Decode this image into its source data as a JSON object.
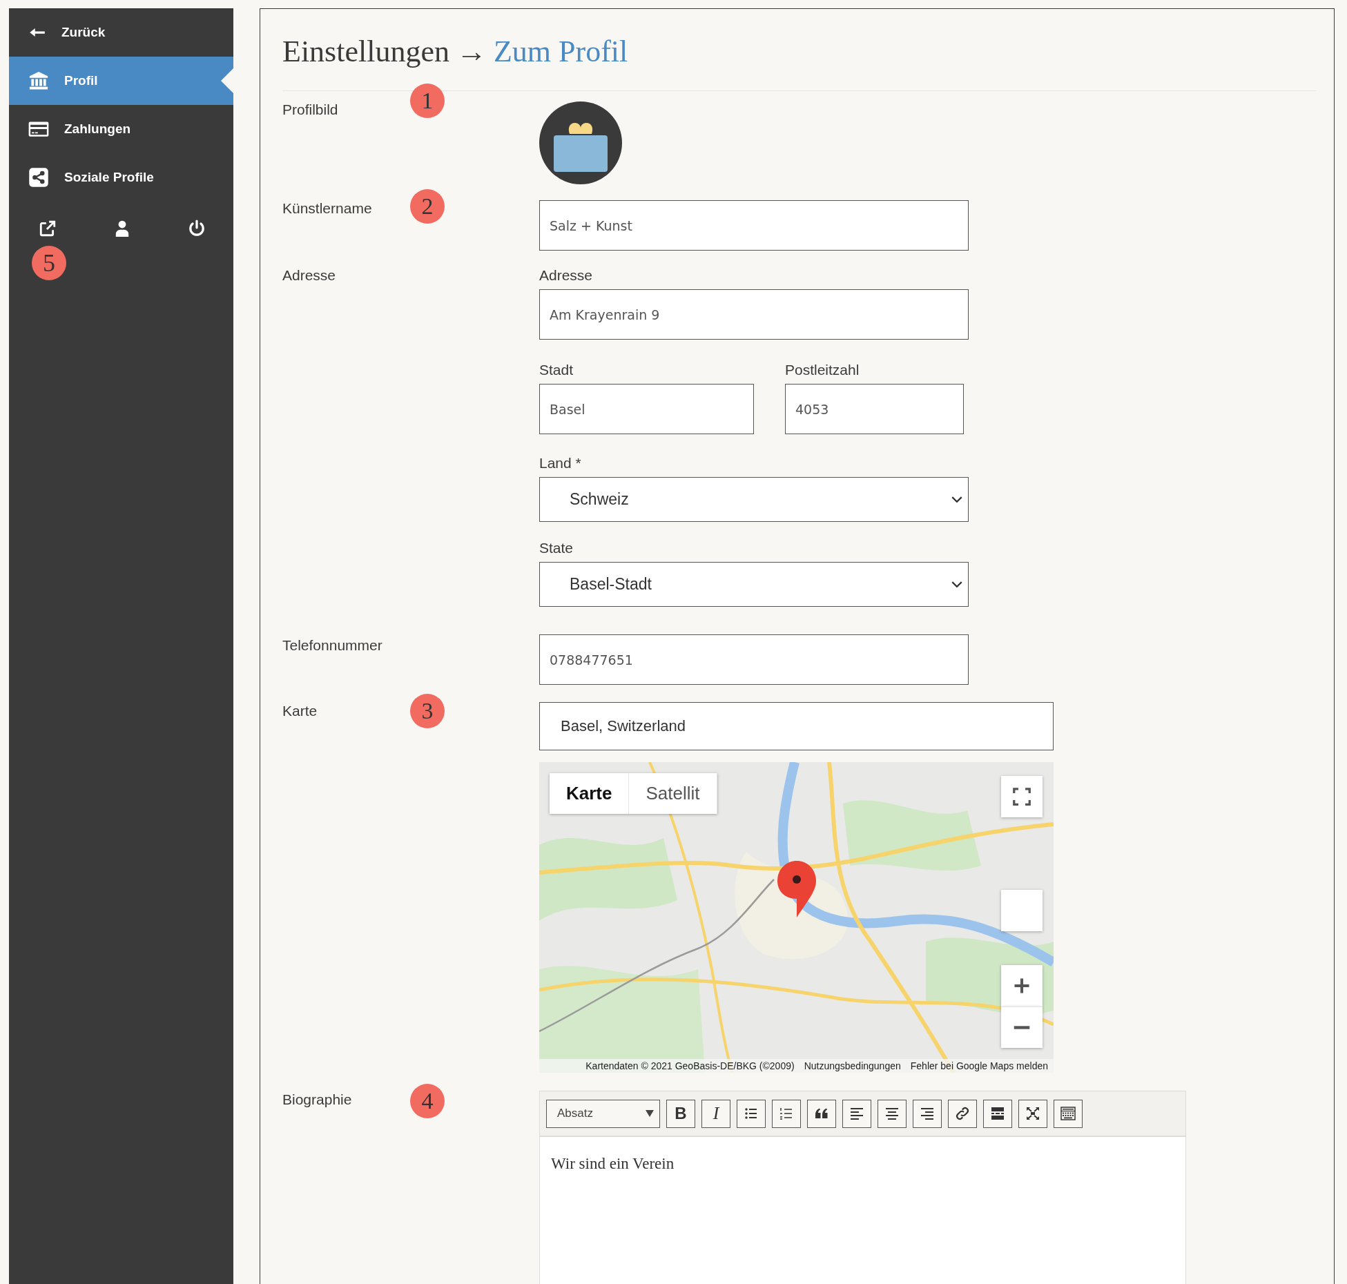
{
  "sidebar": {
    "items": [
      {
        "kind": "back",
        "label": "Zurück",
        "selected": false
      },
      {
        "kind": "bank",
        "label": "Profil",
        "selected": true
      },
      {
        "kind": "card",
        "label": "Zahlungen",
        "selected": false
      },
      {
        "kind": "share",
        "label": "Soziale Profile",
        "selected": false
      }
    ],
    "step": "5"
  },
  "page": {
    "title": "Einstellungen",
    "separator": "→",
    "link": "Zum Profil"
  },
  "profile_image": {
    "label": "Profilbild",
    "step": "1"
  },
  "artist_name": {
    "label": "Künstlername",
    "step": "2",
    "value": "Salz + Kunst"
  },
  "address": {
    "label": "Adresse",
    "street_label": "Adresse",
    "street": "Am Krayenrain 9",
    "city_label": "Stadt",
    "city": "Basel",
    "zip_label": "Postleitzahl",
    "zip": "4053",
    "country_label": "Land *",
    "country": "Schweiz",
    "state_label": "State",
    "state": "Basel-Stadt"
  },
  "phone": {
    "label": "Telefonnummer",
    "value": "0788477651"
  },
  "map": {
    "label": "Karte",
    "step": "3",
    "search": "Basel, Switzerland",
    "map_types": [
      {
        "label": "Karte",
        "selected": true
      },
      {
        "label": "Satellit",
        "selected": false
      }
    ],
    "attribution": [
      "Kartendaten © 2021 GeoBasis-DE/BKG (©2009)",
      "Nutzungsbedingungen",
      "Fehler bei Google Maps melden"
    ]
  },
  "biography": {
    "label": "Biographie",
    "step": "4",
    "format": "Absatz",
    "content": "Wir sind ein Verein",
    "toolbar": [
      {
        "kind": "bold",
        "text": "B"
      },
      {
        "kind": "italic",
        "text": "I"
      },
      {
        "kind": "bullet-list"
      },
      {
        "kind": "numbered-list"
      },
      {
        "kind": "quote"
      },
      {
        "kind": "align-left"
      },
      {
        "kind": "align-center"
      },
      {
        "kind": "align-right"
      },
      {
        "kind": "link"
      },
      {
        "kind": "page-break"
      },
      {
        "kind": "fullscreen"
      },
      {
        "kind": "keyboard"
      }
    ]
  }
}
